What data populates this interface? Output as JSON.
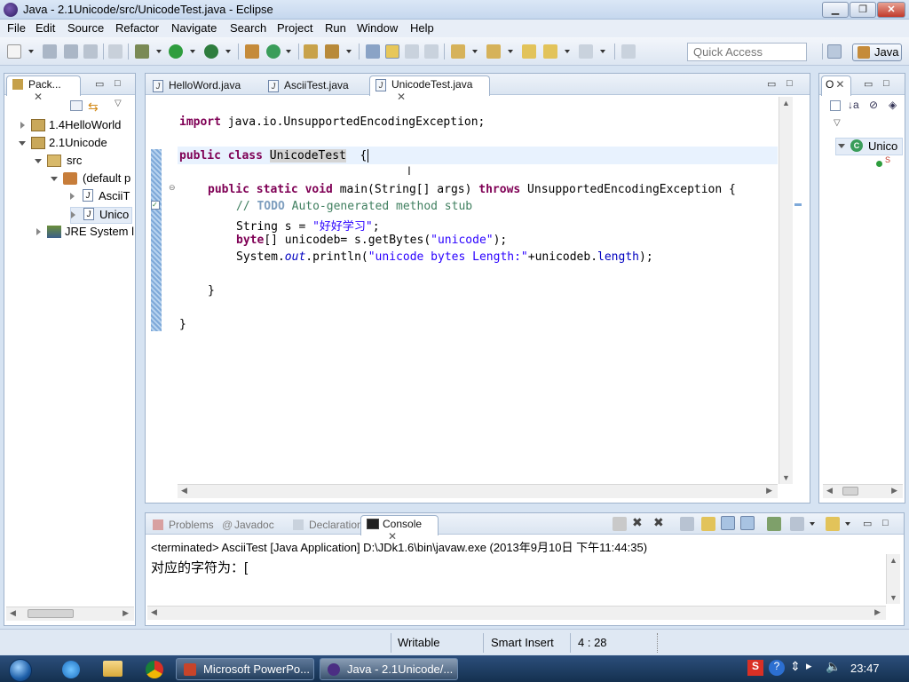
{
  "window": {
    "title": "Java - 2.1Unicode/src/UnicodeTest.java - Eclipse"
  },
  "menu": [
    "File",
    "Edit",
    "Source",
    "Refactor",
    "Navigate",
    "Search",
    "Project",
    "Run",
    "Window",
    "Help"
  ],
  "toolbar": {
    "quick_access_placeholder": "Quick Access",
    "perspective": "Java"
  },
  "package_explorer": {
    "tab_label": "Pack...",
    "tree": [
      {
        "label": "1.4HelloWorld",
        "icon": "project-icon"
      },
      {
        "label": "2.1Unicode",
        "icon": "project-icon"
      },
      {
        "label": "src",
        "icon": "source-folder-icon"
      },
      {
        "label": "(default p",
        "icon": "package-icon"
      },
      {
        "label": "AsciiT",
        "icon": "java-file-icon"
      },
      {
        "label": "Unico",
        "icon": "java-file-icon"
      },
      {
        "label": "JRE System l",
        "icon": "library-icon"
      }
    ]
  },
  "editor": {
    "tabs": [
      "HelloWord.java",
      "AsciiTest.java",
      "UnicodeTest.java"
    ],
    "active_tab": "UnicodeTest.java",
    "code": {
      "import_kw": "import",
      "import_rest": " java.io.UnsupportedEncodingException;",
      "class_decl_kw": "public class",
      "class_name": "UnicodeTest",
      "class_brace": "  {",
      "main_kw": "public static void",
      "main_sig": " main(String[] args) ",
      "throws_kw": "throws",
      "main_exc": " UnsupportedEncodingException {",
      "comment_prefix": "// ",
      "comment_todo": "TODO",
      "comment_rest": " Auto-generated method stub",
      "str_decl": "String s = ",
      "str_value": "\"好好学习\"",
      "str_end": ";",
      "byte_kw": "byte",
      "byte_mid": "[] unicodeb= s.getBytes(",
      "byte_str": "\"unicode\"",
      "byte_end": ");",
      "print_pre": "System.",
      "print_out": "out",
      "print_mid": ".println(",
      "print_str": "\"unicode bytes Length:\"",
      "print_plus": "+unicodeb.",
      "print_len": "length",
      "print_end": ");",
      "close_method": "}",
      "close_class": "}"
    }
  },
  "outline": {
    "tab_label": "O",
    "item": "Unico",
    "sub": "S"
  },
  "console_view": {
    "tabs": [
      "Problems",
      "Javadoc",
      "Declaration",
      "Console"
    ],
    "active_tab": "Console",
    "header": "<terminated> AsciiTest [Java Application] D:\\JDk1.6\\bin\\javaw.exe (2013年9月10日 下午11:44:35)",
    "output": "对应的字符为：["
  },
  "status": {
    "writable": "Writable",
    "insert_mode": "Smart Insert",
    "position": "4 : 28"
  },
  "taskbar": {
    "items": [
      "Microsoft PowerPo...",
      "Java - 2.1Unicode/..."
    ],
    "clock": "23:47"
  }
}
